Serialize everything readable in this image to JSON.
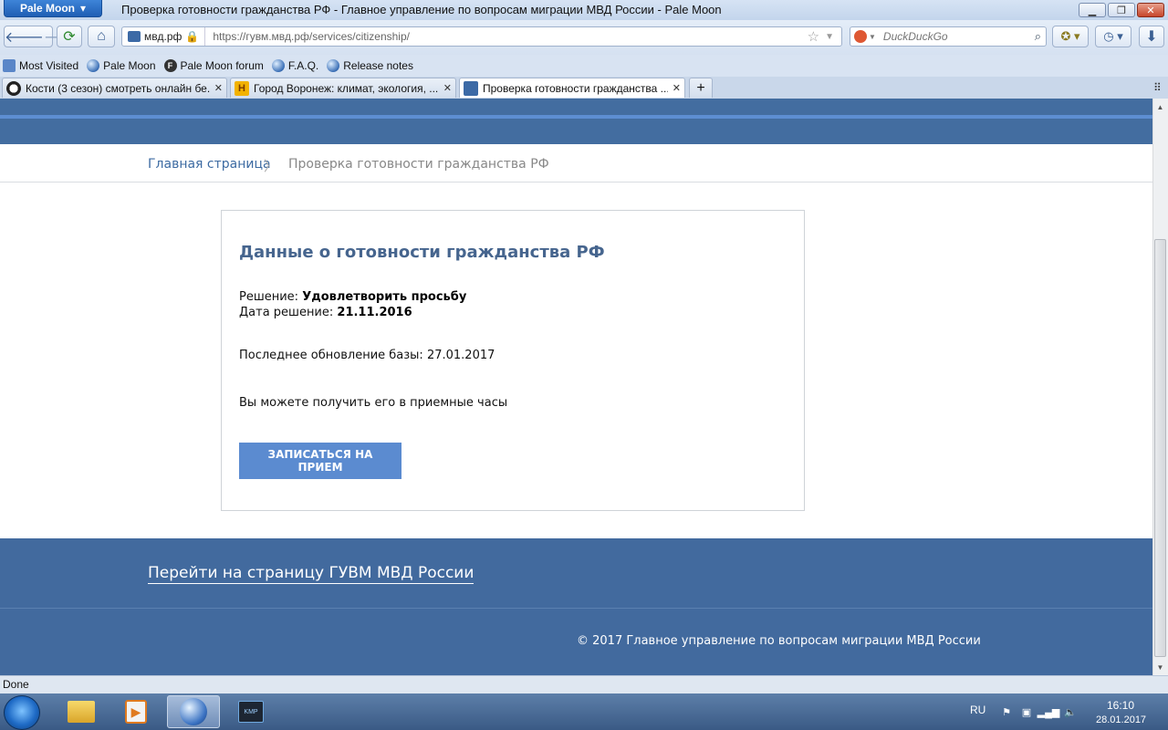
{
  "browser": {
    "app_button": "Pale Moon",
    "window_title": "Проверка готовности гражданства РФ - Главное управление по вопросам миграции МВД России - Pale Moon",
    "url_site": "мвд.рф",
    "url": "https://гувм.мвд.рф/services/citizenship/",
    "search_placeholder": "DuckDuckGo",
    "status": "Done"
  },
  "bookmarks": [
    {
      "label": "Most Visited"
    },
    {
      "label": "Pale Moon"
    },
    {
      "label": "Pale Moon forum"
    },
    {
      "label": "F.A.Q."
    },
    {
      "label": "Release notes"
    }
  ],
  "tabs": [
    {
      "label": "Кости (3 сезон) смотреть онлайн бе...",
      "active": false
    },
    {
      "label": "Город Воронеж: климат, экология, ...",
      "active": false
    },
    {
      "label": "Проверка готовности гражданства ...",
      "active": true
    }
  ],
  "breadcrumb": {
    "home": "Главная страница",
    "current": "Проверка готовности гражданства РФ"
  },
  "card": {
    "title": "Данные о готовности гражданства РФ",
    "decision_label": "Решение:",
    "decision_value": "Удовлетворить просьбу",
    "date_label": "Дата решение:",
    "date_value": "21.11.2016",
    "db_update": "Последнее обновление базы: 27.01.2017",
    "note": "Вы можете получить его в приемные часы",
    "button": "ЗАПИСАТЬСЯ НА ПРИЕМ"
  },
  "footer": {
    "link": "Перейти на страницу ГУВМ МВД России",
    "copyright": "© 2017 Главное управление по вопросам миграции МВД России"
  },
  "taskbar": {
    "lang": "RU",
    "time": "16:10",
    "date": "28.01.2017"
  },
  "colors": {
    "header": "#436da0",
    "accent": "#5b8bd0",
    "footer": "#426a9e"
  }
}
